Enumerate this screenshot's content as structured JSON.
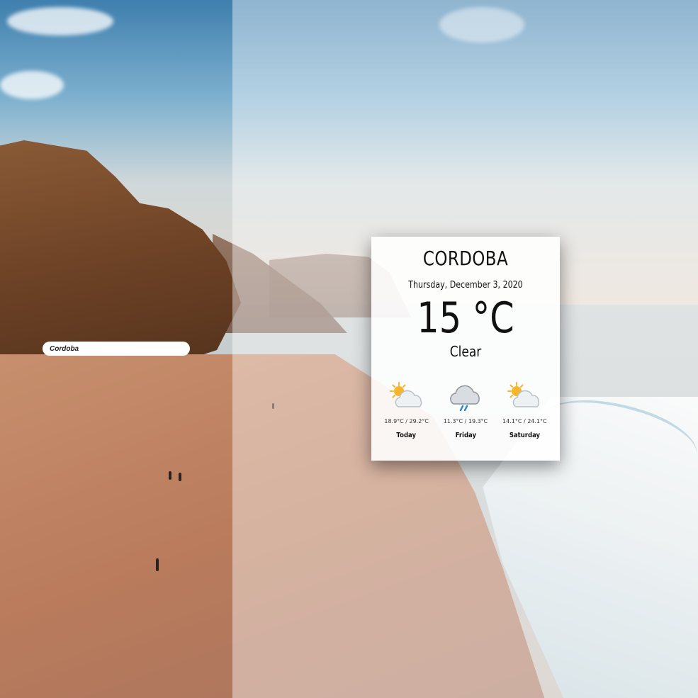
{
  "search": {
    "value": "Cordoba",
    "icon": "none"
  },
  "weather": {
    "city": "CORDOBA",
    "date": "Thursday, December 3, 2020",
    "temperature": "15 °C",
    "condition": "Clear",
    "forecast": [
      {
        "day": "Today",
        "range": "18.9°C / 29.2°C",
        "icon": "partly-sunny-icon"
      },
      {
        "day": "Friday",
        "range": "11.3°C / 19.3°C",
        "icon": "rain-cloud-icon"
      },
      {
        "day": "Saturday",
        "range": "14.1°C / 24.1°C",
        "icon": "partly-sunny-icon"
      }
    ]
  },
  "colors": {
    "sun": "#f6b52a",
    "cloud": "#e9edf0",
    "rain": "#2b8bd6"
  }
}
